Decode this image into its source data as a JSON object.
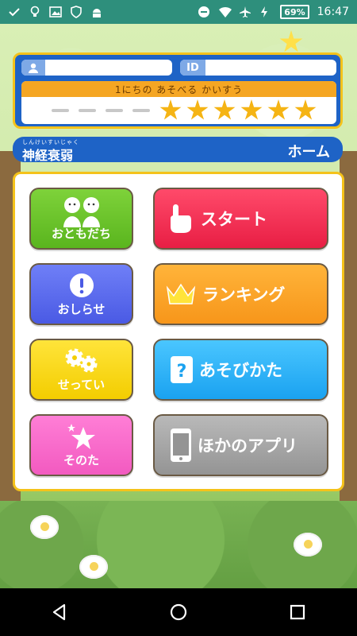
{
  "status_bar": {
    "time": "16:47",
    "battery_percent": "69%",
    "icons_left": [
      "check-icon",
      "lightbulb-icon",
      "image-icon",
      "shield-icon",
      "android-icon"
    ],
    "icons_right": [
      "dnd-icon",
      "wifi-icon",
      "airplane-icon",
      "battery-icon"
    ]
  },
  "info_panel": {
    "id_label": "ID",
    "daily_plays_label": "1にちの あそべる かいすう",
    "plays_used": 4,
    "plays_remaining": 6
  },
  "title_bar": {
    "furigana": "しんけいすいじゃく",
    "app_title": "神経衰弱",
    "page_name": "ホーム"
  },
  "menu": {
    "friends": "おともだち",
    "start": "スタート",
    "news": "おしらせ",
    "ranking": "ランキング",
    "settings": "せってい",
    "how_to_play": "あそびかた",
    "other": "そのた",
    "other_apps": "ほかのアプリ"
  },
  "colors": {
    "panel_blue": "#1e63c6",
    "panel_border": "#f4c21a",
    "star": "#f5b414",
    "statusbar": "#2e8f7c"
  }
}
